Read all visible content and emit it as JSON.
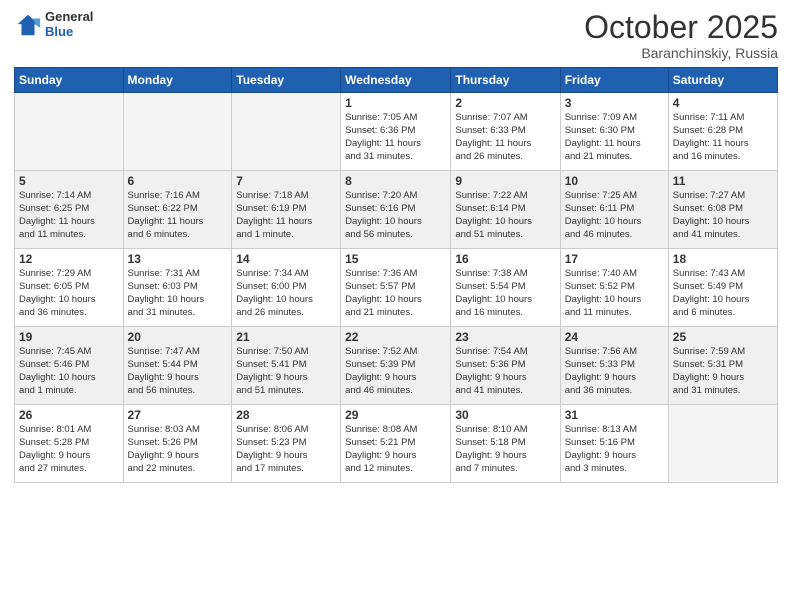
{
  "header": {
    "logo_general": "General",
    "logo_blue": "Blue",
    "month_year": "October 2025",
    "location": "Baranchinskiy, Russia"
  },
  "weekdays": [
    "Sunday",
    "Monday",
    "Tuesday",
    "Wednesday",
    "Thursday",
    "Friday",
    "Saturday"
  ],
  "weeks": [
    [
      {
        "day": "",
        "info": ""
      },
      {
        "day": "",
        "info": ""
      },
      {
        "day": "",
        "info": ""
      },
      {
        "day": "1",
        "info": "Sunrise: 7:05 AM\nSunset: 6:36 PM\nDaylight: 11 hours\nand 31 minutes."
      },
      {
        "day": "2",
        "info": "Sunrise: 7:07 AM\nSunset: 6:33 PM\nDaylight: 11 hours\nand 26 minutes."
      },
      {
        "day": "3",
        "info": "Sunrise: 7:09 AM\nSunset: 6:30 PM\nDaylight: 11 hours\nand 21 minutes."
      },
      {
        "day": "4",
        "info": "Sunrise: 7:11 AM\nSunset: 6:28 PM\nDaylight: 11 hours\nand 16 minutes."
      }
    ],
    [
      {
        "day": "5",
        "info": "Sunrise: 7:14 AM\nSunset: 6:25 PM\nDaylight: 11 hours\nand 11 minutes."
      },
      {
        "day": "6",
        "info": "Sunrise: 7:16 AM\nSunset: 6:22 PM\nDaylight: 11 hours\nand 6 minutes."
      },
      {
        "day": "7",
        "info": "Sunrise: 7:18 AM\nSunset: 6:19 PM\nDaylight: 11 hours\nand 1 minute."
      },
      {
        "day": "8",
        "info": "Sunrise: 7:20 AM\nSunset: 6:16 PM\nDaylight: 10 hours\nand 56 minutes."
      },
      {
        "day": "9",
        "info": "Sunrise: 7:22 AM\nSunset: 6:14 PM\nDaylight: 10 hours\nand 51 minutes."
      },
      {
        "day": "10",
        "info": "Sunrise: 7:25 AM\nSunset: 6:11 PM\nDaylight: 10 hours\nand 46 minutes."
      },
      {
        "day": "11",
        "info": "Sunrise: 7:27 AM\nSunset: 6:08 PM\nDaylight: 10 hours\nand 41 minutes."
      }
    ],
    [
      {
        "day": "12",
        "info": "Sunrise: 7:29 AM\nSunset: 6:05 PM\nDaylight: 10 hours\nand 36 minutes."
      },
      {
        "day": "13",
        "info": "Sunrise: 7:31 AM\nSunset: 6:03 PM\nDaylight: 10 hours\nand 31 minutes."
      },
      {
        "day": "14",
        "info": "Sunrise: 7:34 AM\nSunset: 6:00 PM\nDaylight: 10 hours\nand 26 minutes."
      },
      {
        "day": "15",
        "info": "Sunrise: 7:36 AM\nSunset: 5:57 PM\nDaylight: 10 hours\nand 21 minutes."
      },
      {
        "day": "16",
        "info": "Sunrise: 7:38 AM\nSunset: 5:54 PM\nDaylight: 10 hours\nand 16 minutes."
      },
      {
        "day": "17",
        "info": "Sunrise: 7:40 AM\nSunset: 5:52 PM\nDaylight: 10 hours\nand 11 minutes."
      },
      {
        "day": "18",
        "info": "Sunrise: 7:43 AM\nSunset: 5:49 PM\nDaylight: 10 hours\nand 6 minutes."
      }
    ],
    [
      {
        "day": "19",
        "info": "Sunrise: 7:45 AM\nSunset: 5:46 PM\nDaylight: 10 hours\nand 1 minute."
      },
      {
        "day": "20",
        "info": "Sunrise: 7:47 AM\nSunset: 5:44 PM\nDaylight: 9 hours\nand 56 minutes."
      },
      {
        "day": "21",
        "info": "Sunrise: 7:50 AM\nSunset: 5:41 PM\nDaylight: 9 hours\nand 51 minutes."
      },
      {
        "day": "22",
        "info": "Sunrise: 7:52 AM\nSunset: 5:39 PM\nDaylight: 9 hours\nand 46 minutes."
      },
      {
        "day": "23",
        "info": "Sunrise: 7:54 AM\nSunset: 5:36 PM\nDaylight: 9 hours\nand 41 minutes."
      },
      {
        "day": "24",
        "info": "Sunrise: 7:56 AM\nSunset: 5:33 PM\nDaylight: 9 hours\nand 36 minutes."
      },
      {
        "day": "25",
        "info": "Sunrise: 7:59 AM\nSunset: 5:31 PM\nDaylight: 9 hours\nand 31 minutes."
      }
    ],
    [
      {
        "day": "26",
        "info": "Sunrise: 8:01 AM\nSunset: 5:28 PM\nDaylight: 9 hours\nand 27 minutes."
      },
      {
        "day": "27",
        "info": "Sunrise: 8:03 AM\nSunset: 5:26 PM\nDaylight: 9 hours\nand 22 minutes."
      },
      {
        "day": "28",
        "info": "Sunrise: 8:06 AM\nSunset: 5:23 PM\nDaylight: 9 hours\nand 17 minutes."
      },
      {
        "day": "29",
        "info": "Sunrise: 8:08 AM\nSunset: 5:21 PM\nDaylight: 9 hours\nand 12 minutes."
      },
      {
        "day": "30",
        "info": "Sunrise: 8:10 AM\nSunset: 5:18 PM\nDaylight: 9 hours\nand 7 minutes."
      },
      {
        "day": "31",
        "info": "Sunrise: 8:13 AM\nSunset: 5:16 PM\nDaylight: 9 hours\nand 3 minutes."
      },
      {
        "day": "",
        "info": ""
      }
    ]
  ]
}
